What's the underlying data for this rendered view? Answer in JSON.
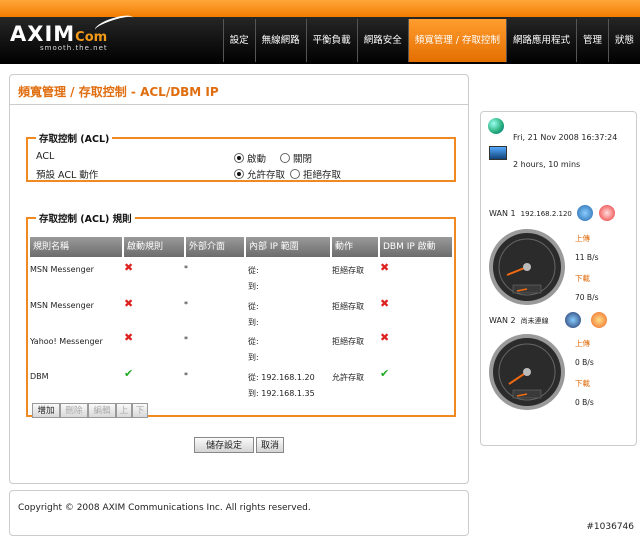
{
  "header": {
    "logo_main": "AXIM",
    "logo_com": "Com",
    "logo_tagline": "smooth.the.net",
    "nav": [
      "設定",
      "無線網路",
      "平衡負載",
      "網路安全",
      "頻寬管理 / 存取控制",
      "網路應用程式",
      "管理",
      "狀態"
    ],
    "active_index": 4
  },
  "page_title": "頻寬管理 / 存取控制 - ACL/DBM IP",
  "acl": {
    "legend": "存取控制 (ACL)",
    "acl_label": "ACL",
    "acl_on": "啟動",
    "acl_off": "關閉",
    "default_label": "預設 ACL 動作",
    "default_allow": "允許存取",
    "default_deny": "拒絕存取"
  },
  "rules": {
    "legend": "存取控制 (ACL) 規則",
    "columns": [
      "規則名稱",
      "啟動規則",
      "外部介面",
      "內部 IP 範圍",
      "動作",
      "DBM IP 啟動"
    ],
    "rows": [
      {
        "name": "MSN Messenger",
        "enabled": "x",
        "iface": "*",
        "from": "從:",
        "from_ip": "",
        "to": "到:",
        "to_ip": "",
        "action": "拒絕存取",
        "dbm": "x"
      },
      {
        "name": "MSN Messenger",
        "enabled": "x",
        "iface": "*",
        "from": "從:",
        "from_ip": "",
        "to": "到:",
        "to_ip": "",
        "action": "拒絕存取",
        "dbm": "x"
      },
      {
        "name": "Yahoo! Messenger",
        "enabled": "x",
        "iface": "*",
        "from": "從:",
        "from_ip": "",
        "to": "到:",
        "to_ip": "",
        "action": "拒絕存取",
        "dbm": "x"
      },
      {
        "name": "DBM",
        "enabled": "check",
        "iface": "*",
        "from": "從:",
        "from_ip": "192.168.1.20",
        "to": "到:",
        "to_ip": "192.168.1.35",
        "action": "允許存取",
        "dbm": "check"
      }
    ],
    "buttons": {
      "add": "增加",
      "delete": "刪除",
      "edit": "編輯",
      "up": "上",
      "down": "下"
    }
  },
  "save_label": "儲存設定",
  "cancel_label": "取消",
  "footer": "Copyright © 2008 AXIM Communications Inc. All rights reserved.",
  "status": {
    "datetime": "Fri, 21 Nov 2008 16:37:24",
    "uptime": "2 hours, 10 mins",
    "wan1_label": "WAN 1",
    "wan1_ip": "192.168.2.120",
    "wan1_upload_label": "上傳",
    "wan1_upload": "11 B/s",
    "wan1_download_label": "下載",
    "wan1_download": "70 B/s",
    "wan2_label": "WAN 2",
    "wan2_ip": "尚未連線",
    "wan2_upload_label": "上傳",
    "wan2_upload": "0 B/s",
    "wan2_download_label": "下載",
    "wan2_download": "0 B/s"
  },
  "watermark": "#1036746"
}
